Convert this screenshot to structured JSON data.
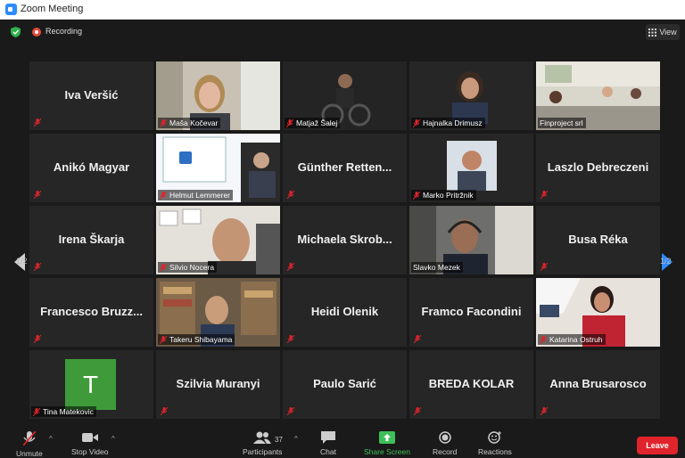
{
  "window": {
    "title": "Zoom Meeting"
  },
  "header": {
    "recording_label": "Recording",
    "view_label": "View"
  },
  "pager": {
    "left": "1/2",
    "right": "1/2"
  },
  "tiles": [
    {
      "display": "Iva Veršić",
      "label": ""
    },
    {
      "display": "",
      "label": "Maša Kočevar"
    },
    {
      "display": "",
      "label": "Matjaž Šalej"
    },
    {
      "display": "",
      "label": "Hajnalka Drimusz"
    },
    {
      "display": "",
      "label": "Finproject srl"
    },
    {
      "display": "Anikó Magyar",
      "label": ""
    },
    {
      "display": "",
      "label": "Helmut Lemmerer"
    },
    {
      "display": "Günther Retten...",
      "label": ""
    },
    {
      "display": "",
      "label": "Marko Pritržnik"
    },
    {
      "display": "Laszlo Debreczeni",
      "label": ""
    },
    {
      "display": "Irena Škarja",
      "label": ""
    },
    {
      "display": "",
      "label": "Silvio Nocera"
    },
    {
      "display": "Michaela Skrob...",
      "label": ""
    },
    {
      "display": "",
      "label": "Slavko Mezek"
    },
    {
      "display": "Busa Réka",
      "label": ""
    },
    {
      "display": "Francesco Bruzz...",
      "label": ""
    },
    {
      "display": "",
      "label": "Takeru Shibayama"
    },
    {
      "display": "Heidi Olenik",
      "label": ""
    },
    {
      "display": "Framco Facondini",
      "label": ""
    },
    {
      "display": "",
      "label": "Katarina Ostruh"
    },
    {
      "display": "",
      "label": "Tina Matekovic",
      "avatar_letter": "T"
    },
    {
      "display": "Szilvia Muranyi",
      "label": ""
    },
    {
      "display": "Paulo Sarić",
      "label": ""
    },
    {
      "display": "BREDA KOLAR",
      "label": ""
    },
    {
      "display": "Anna Brusarosco",
      "label": ""
    }
  ],
  "toolbar": {
    "unmute": "Unmute",
    "stop_video": "Stop Video",
    "participants": "Participants",
    "participants_count": "37",
    "chat": "Chat",
    "share_screen": "Share Screen",
    "record": "Record",
    "reactions": "Reactions",
    "leave": "Leave"
  },
  "colors": {
    "active_speaker": "#d6e36f",
    "leave": "#e0242c",
    "share": "#3fbf5a",
    "avatar": "#3f9b3a",
    "recording": "#e8493c"
  }
}
